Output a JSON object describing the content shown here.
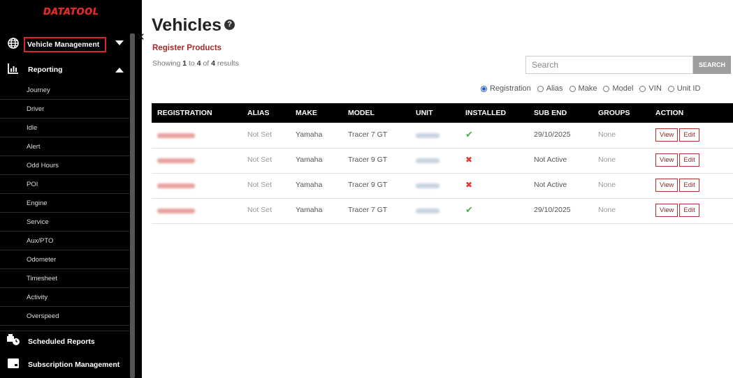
{
  "sidebar": {
    "logo": "DATATOOL",
    "vehicle_management": "Vehicle Management",
    "reporting": "Reporting",
    "report_items": [
      "Journey",
      "Driver",
      "Idle",
      "Alert",
      "Odd Hours",
      "POI",
      "Engine",
      "Service",
      "Aux/PTO",
      "Odometer",
      "Timesheet",
      "Activity",
      "Overspeed"
    ],
    "scheduled_reports": "Scheduled Reports",
    "subscription_management": "Subscription Management"
  },
  "page": {
    "title": "Vehicles",
    "register_link": "Register Products",
    "showing_prefix": "Showing ",
    "showing_from": "1",
    "showing_mid1": " to ",
    "showing_to": "4",
    "showing_mid2": " of ",
    "showing_total": "4",
    "showing_suffix": " results"
  },
  "search": {
    "placeholder": "Search",
    "button": "SEARCH"
  },
  "filters": {
    "selected": "Registration",
    "options": [
      "Registration",
      "Alias",
      "Make",
      "Model",
      "VIN",
      "Unit ID"
    ]
  },
  "table": {
    "headers": [
      "REGISTRATION",
      "ALIAS",
      "MAKE",
      "MODEL",
      "UNIT",
      "INSTALLED",
      "SUB END",
      "GROUPS",
      "ACTION"
    ],
    "rows": [
      {
        "alias": "Not Set",
        "make": "Yamaha",
        "model": "Tracer 7 GT",
        "installed": true,
        "sub_end": "29/10/2025",
        "groups": "None"
      },
      {
        "alias": "Not Set",
        "make": "Yamaha",
        "model": "Tracer 9 GT",
        "installed": false,
        "sub_end": "Not Active",
        "groups": "None"
      },
      {
        "alias": "Not Set",
        "make": "Yamaha",
        "model": "Tracer 9 GT",
        "installed": false,
        "sub_end": "Not Active",
        "groups": "None"
      },
      {
        "alias": "Not Set",
        "make": "Yamaha",
        "model": "Tracer 7 GT",
        "installed": true,
        "sub_end": "29/10/2025",
        "groups": "None"
      }
    ],
    "view_label": "View",
    "edit_label": "Edit"
  },
  "colors": {
    "accent": "#a52a2a",
    "highlight_box": "#d9242a",
    "sidebar_bg": "#000000",
    "radio_selected": "#1f5fcf"
  },
  "icons": {
    "globe": "globe-icon",
    "chart": "bar-chart-icon",
    "scheduled": "truck-clock-icon",
    "subscription": "card-icon",
    "help": "help-icon",
    "close": "close-icon"
  }
}
